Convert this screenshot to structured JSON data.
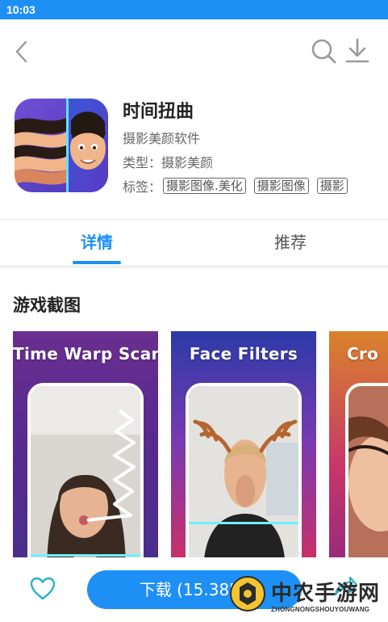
{
  "status_bar": {
    "time": "10:03"
  },
  "nav": {
    "back_icon": "chevron-left-icon",
    "search_icon": "search-icon",
    "download_icon": "download-icon"
  },
  "app": {
    "title": "时间扭曲",
    "category": "摄影美颜软件",
    "type_label": "类型：",
    "type_value": "摄影美颜",
    "tags_label": "标签：",
    "tags": [
      "摄影图像.美化",
      "摄影图像",
      "摄影"
    ]
  },
  "tabs": [
    {
      "label": "详情",
      "active": true
    },
    {
      "label": "推荐",
      "active": false
    }
  ],
  "screenshots_section": {
    "title": "游戏截图",
    "items": [
      {
        "caption": "Time Warp Scan"
      },
      {
        "caption": "Face Filters"
      },
      {
        "caption": "Cro"
      }
    ]
  },
  "bottom_bar": {
    "favorite_icon": "heart-icon",
    "download_label": "下载 (15.38M)",
    "share_icon": "share-icon"
  },
  "watermark": {
    "name": "中农手游网",
    "pinyin": "ZHONGNONGSHOUYOUWANG"
  },
  "colors": {
    "accent": "#1e8ff5",
    "status_bar": "#1e90f5"
  }
}
